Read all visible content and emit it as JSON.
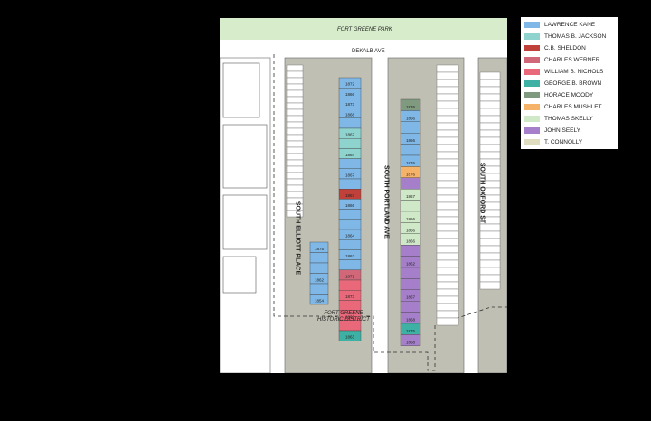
{
  "map": {
    "labels": {
      "park": "FORT GREENE PARK",
      "dekalb": "DEKALB AVE",
      "elliott": "SOUTH ELLIOTT PLACE",
      "portland": "SOUTH PORTLAND AVE",
      "oxford": "SOUTH OXFORD ST",
      "district_line1": "FORT GREENE",
      "district_line2": "HISTORIC DISTRICT"
    },
    "colors": {
      "park": "#d6eccb",
      "street": "#ffffff",
      "block": "#bfbfb3",
      "building_outline": "#555555"
    }
  },
  "legend": {
    "items": [
      {
        "label": "LAWRENCE KANE",
        "color": "#7fb8e6"
      },
      {
        "label": "THOMAS B. JACKSON",
        "color": "#8fd3cf"
      },
      {
        "label": "C.B. SHELDON",
        "color": "#c0413a"
      },
      {
        "label": "CHARLES WERNER",
        "color": "#d1687a"
      },
      {
        "label": "WILLIAM B. NICHOLS",
        "color": "#e9697a"
      },
      {
        "label": "GEORGE B. BROWN",
        "color": "#3fb0a4"
      },
      {
        "label": "HORACE MOODY",
        "color": "#7f9a7f"
      },
      {
        "label": "CHARLES MUSHLET",
        "color": "#f5b36a"
      },
      {
        "label": "THOMAS SKELLY",
        "color": "#cfe8c8"
      },
      {
        "label": "JOHN SEELY",
        "color": "#a57fc9"
      },
      {
        "label": "T. CONNOLLY",
        "color": "#e0dcc0"
      }
    ]
  },
  "row_houses": {
    "portland_west": [
      {
        "year": "1872",
        "owner": 0
      },
      {
        "year": "1866",
        "owner": 0
      },
      {
        "year": "1873",
        "owner": 0
      },
      {
        "year": "1866",
        "owner": 0
      },
      {
        "year": "",
        "owner": 0
      },
      {
        "year": "1867",
        "owner": 1
      },
      {
        "year": "",
        "owner": 1
      },
      {
        "year": "1864",
        "owner": 1
      },
      {
        "year": "",
        "owner": 0
      },
      {
        "year": "1867",
        "owner": 0
      },
      {
        "year": "",
        "owner": 0
      },
      {
        "year": "1867",
        "owner": 2
      },
      {
        "year": "1866",
        "owner": 0
      },
      {
        "year": "",
        "owner": 0
      },
      {
        "year": "",
        "owner": 0
      },
      {
        "year": "1864",
        "owner": 0
      },
      {
        "year": "",
        "owner": 0
      },
      {
        "year": "1863",
        "owner": 0
      },
      {
        "year": "",
        "owner": 0
      },
      {
        "year": "1871",
        "owner": 3
      },
      {
        "year": "",
        "owner": 4
      },
      {
        "year": "1873",
        "owner": 4
      },
      {
        "year": "",
        "owner": 4
      },
      {
        "year": "1862",
        "owner": 4
      },
      {
        "year": "",
        "owner": 4
      },
      {
        "year": "1863",
        "owner": 5
      }
    ],
    "portland_east": [
      {
        "year": "1876",
        "owner": 6
      },
      {
        "year": "1866",
        "owner": 0
      },
      {
        "year": "",
        "owner": 0
      },
      {
        "year": "1866",
        "owner": 0
      },
      {
        "year": "",
        "owner": 0
      },
      {
        "year": "1876",
        "owner": 0
      },
      {
        "year": "1876",
        "owner": 7
      },
      {
        "year": "",
        "owner": 9
      },
      {
        "year": "1867",
        "owner": 8
      },
      {
        "year": "",
        "owner": 8
      },
      {
        "year": "1866",
        "owner": 8
      },
      {
        "year": "1866",
        "owner": 8
      },
      {
        "year": "1866",
        "owner": 8
      },
      {
        "year": "",
        "owner": 9
      },
      {
        "year": "1862",
        "owner": 9
      },
      {
        "year": "",
        "owner": 9
      },
      {
        "year": "",
        "owner": 9
      },
      {
        "year": "1867",
        "owner": 9
      },
      {
        "year": "",
        "owner": 9
      },
      {
        "year": "1868",
        "owner": 9
      },
      {
        "year": "1875",
        "owner": 5
      },
      {
        "year": "1868",
        "owner": 9
      }
    ],
    "elliott_east": [
      {
        "year": "1875",
        "owner": 0
      },
      {
        "year": "",
        "owner": 0
      },
      {
        "year": "",
        "owner": 0
      },
      {
        "year": "1862",
        "owner": 0
      },
      {
        "year": "",
        "owner": 0
      },
      {
        "year": "1854",
        "owner": 0
      }
    ]
  }
}
